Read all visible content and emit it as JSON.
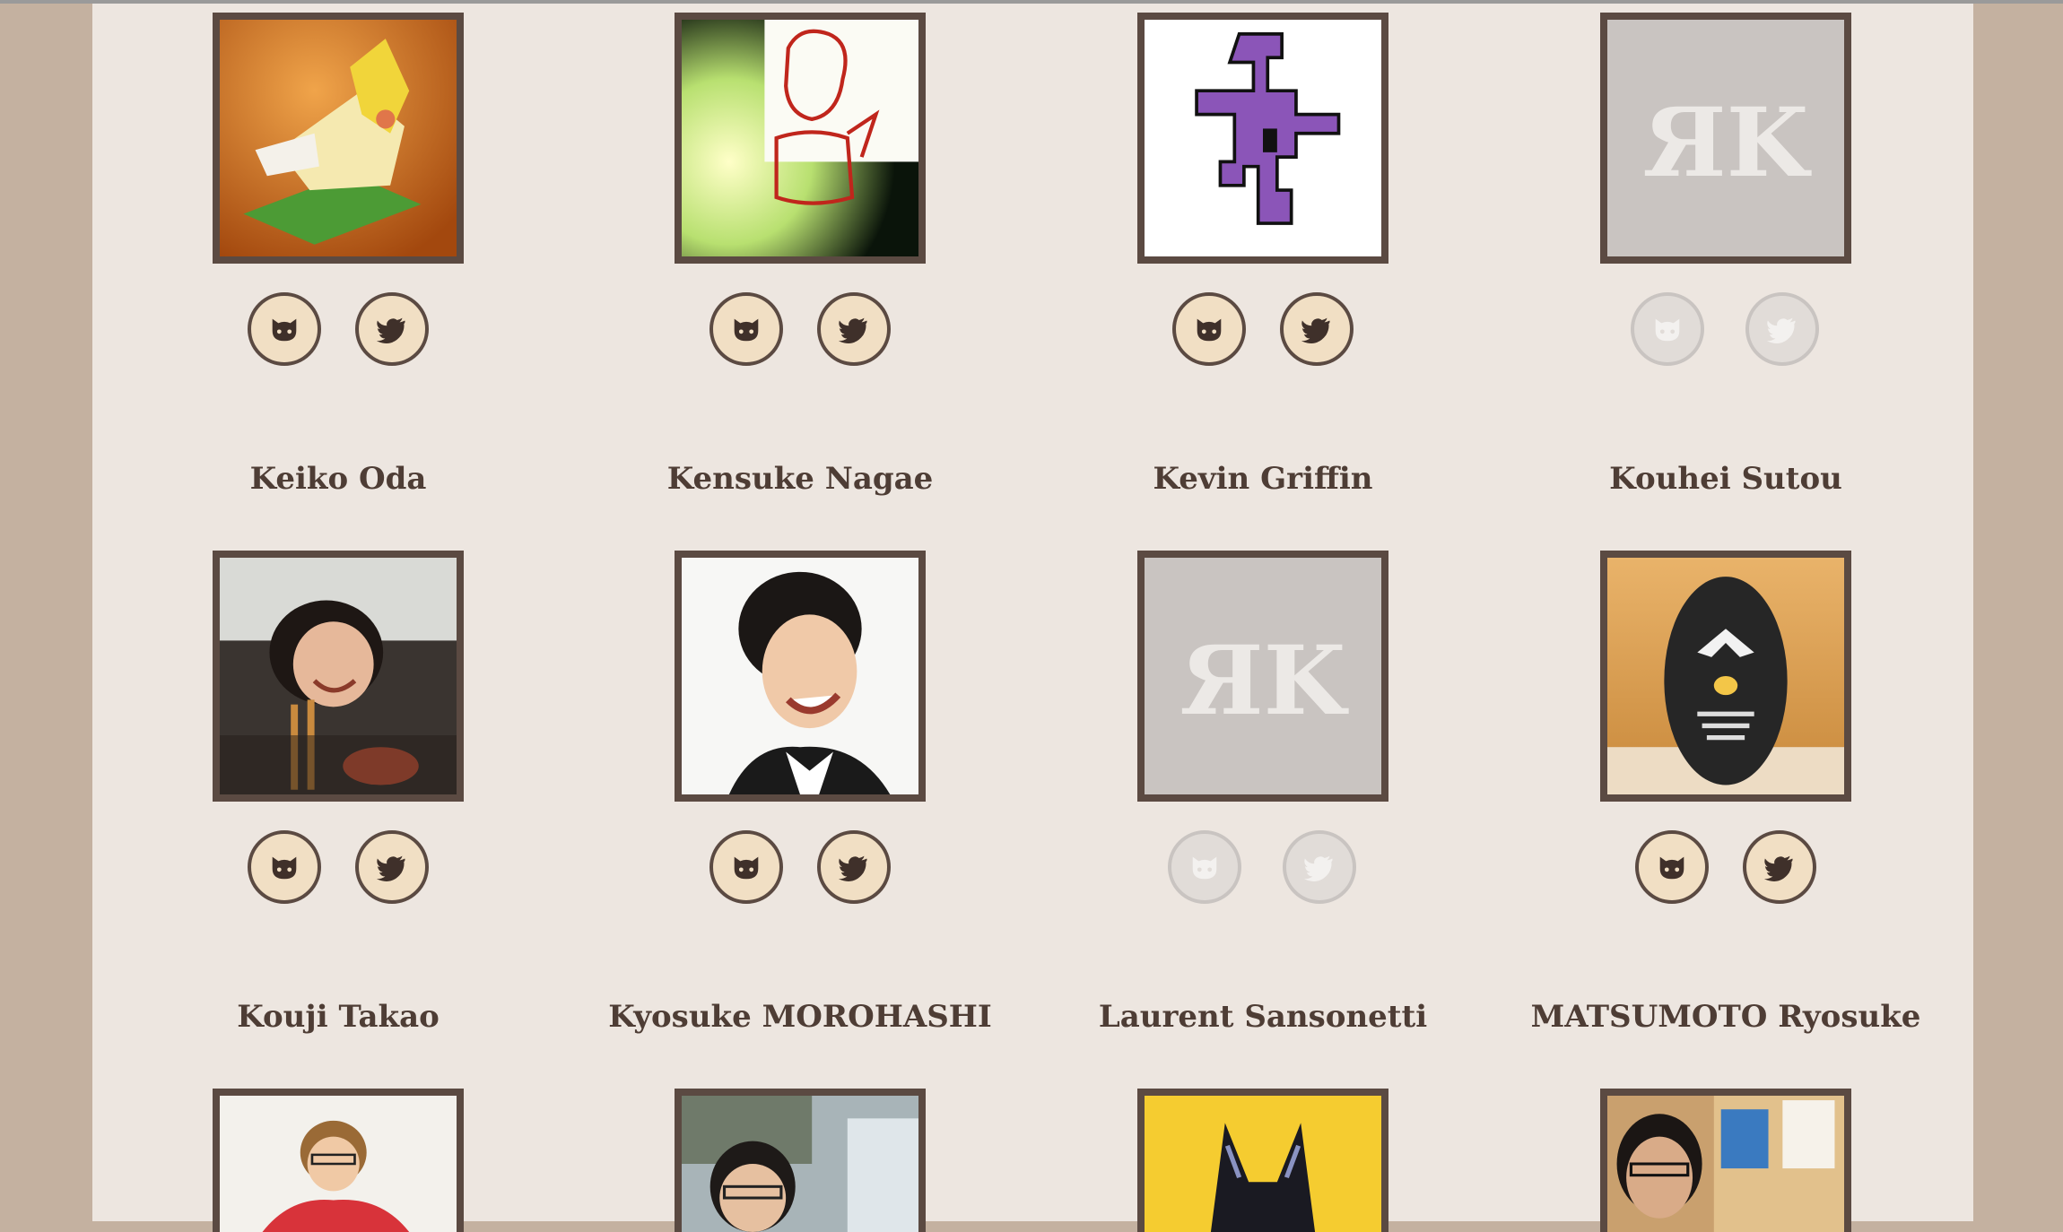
{
  "members": [
    {
      "name": "",
      "avatar": "cockatiel-lego-photo",
      "github_icon": "github-icon",
      "twitter_icon": "twitter-icon",
      "github_active": true,
      "twitter_active": true
    },
    {
      "name": "",
      "avatar": "sketch-drawing",
      "github_icon": "github-icon",
      "twitter_icon": "twitter-icon",
      "github_active": true,
      "twitter_active": true
    },
    {
      "name": "",
      "avatar": "pixel-art-figure",
      "github_icon": "github-icon",
      "twitter_icon": "twitter-icon",
      "github_active": true,
      "twitter_active": true
    },
    {
      "name": "",
      "avatar": "rk-placeholder-logo",
      "github_icon": "github-icon",
      "twitter_icon": "twitter-icon",
      "github_active": false,
      "twitter_active": false
    },
    {
      "name": "Keiko Oda",
      "avatar": "person-photo",
      "github_icon": "github-icon",
      "twitter_icon": "twitter-icon",
      "github_active": true,
      "twitter_active": true
    },
    {
      "name": "Kensuke Nagae",
      "avatar": "person-photo",
      "github_icon": "github-icon",
      "twitter_icon": "twitter-icon",
      "github_active": true,
      "twitter_active": true
    },
    {
      "name": "Kevin Griffin",
      "avatar": "rk-placeholder-logo",
      "github_icon": "github-icon",
      "twitter_icon": "twitter-icon",
      "github_active": false,
      "twitter_active": false
    },
    {
      "name": "Kouhei Sutou",
      "avatar": "mask-figure-photo",
      "github_icon": "github-icon",
      "twitter_icon": "twitter-icon",
      "github_active": true,
      "twitter_active": true
    },
    {
      "name": "Kouji Takao",
      "avatar": "person-photo"
    },
    {
      "name": "Kyosuke MOROHASHI",
      "avatar": "person-photo"
    },
    {
      "name": "Laurent Sansonetti",
      "avatar": "cat-illustration"
    },
    {
      "name": "MATSUMOTO Ryosuke",
      "avatar": "person-photo"
    }
  ],
  "placeholder_logo_text": "ЯK",
  "colors": {
    "border": "#5b4a42",
    "icon_bg": "#f1dfc4",
    "icon_disabled": "#c9c4c1",
    "name_text": "#4e3d35",
    "page_bg": "#ede6e0",
    "outer_bg": "#c4b1a0"
  }
}
